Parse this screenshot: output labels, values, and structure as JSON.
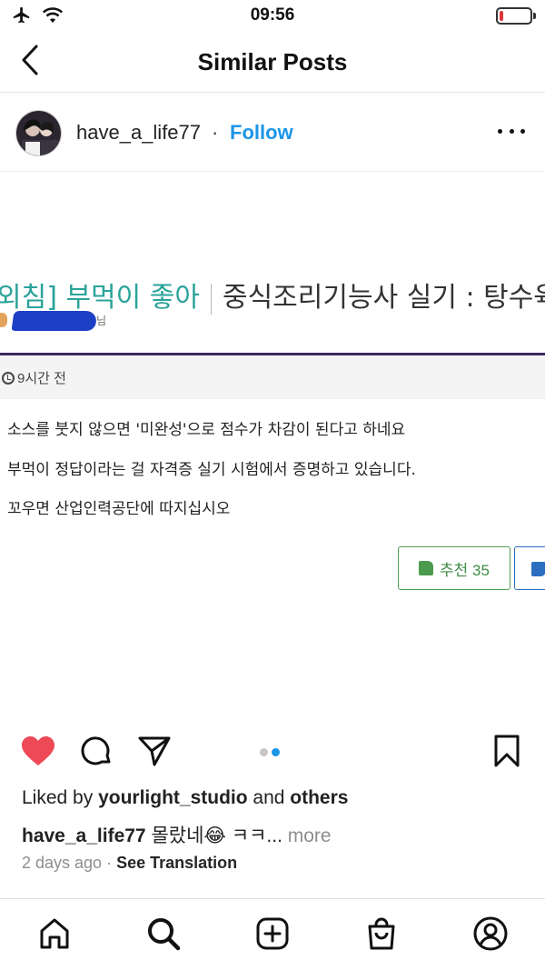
{
  "status_bar": {
    "time": "09:56",
    "icons": [
      "airplane-icon",
      "wifi-icon",
      "battery-low-icon"
    ],
    "battery_level": 0.12,
    "battery_color": "#e0353b"
  },
  "header": {
    "title": "Similar Posts",
    "back_icon": "chevron-left-icon"
  },
  "post": {
    "username": "have_a_life77",
    "separator": "·",
    "follow_label": "Follow",
    "follow_color": "#1a95e8",
    "more_icon": "more-horizontal-icon"
  },
  "post_image": {
    "cafe_name": "외침] 부먹이 좋아",
    "post_title": "중식조리기능사 실기 : 탕수육,",
    "author_suffix": "님",
    "time_ago": "9시간 전",
    "body_lines": [
      "소스를 붓지 않으면 '미완성'으로 점수가 차감이 된다고 하네요",
      "부먹이 정답이라는 걸 자격증 실기 시험에서 증명하고 있습니다.",
      "꼬우면 산업인력공단에 따지십시오"
    ],
    "recommend_label": "추천 35",
    "accent_teal": "#2aa39a",
    "rule_color": "#3d2a63"
  },
  "actions": {
    "icons": [
      "heart-filled-icon",
      "comment-icon",
      "share-icon",
      "bookmark-icon"
    ],
    "heart_color": "#ed4956",
    "pager_active_color": "#1a95e8",
    "page_count": 2,
    "active_page": 2
  },
  "likes": {
    "prefix": "Liked by ",
    "user": "yourlight_studio",
    "middle": " and ",
    "others": "others"
  },
  "caption": {
    "username": "have_a_life77",
    "text": " 몰랐네😂 ㅋㅋ...",
    "more": " more"
  },
  "meta": {
    "time": "2 days ago",
    "separator": " · ",
    "translation": "See Translation"
  },
  "bottom_nav": {
    "items": [
      "home-icon",
      "search-icon",
      "new-post-icon",
      "shop-icon",
      "profile-icon"
    ]
  }
}
